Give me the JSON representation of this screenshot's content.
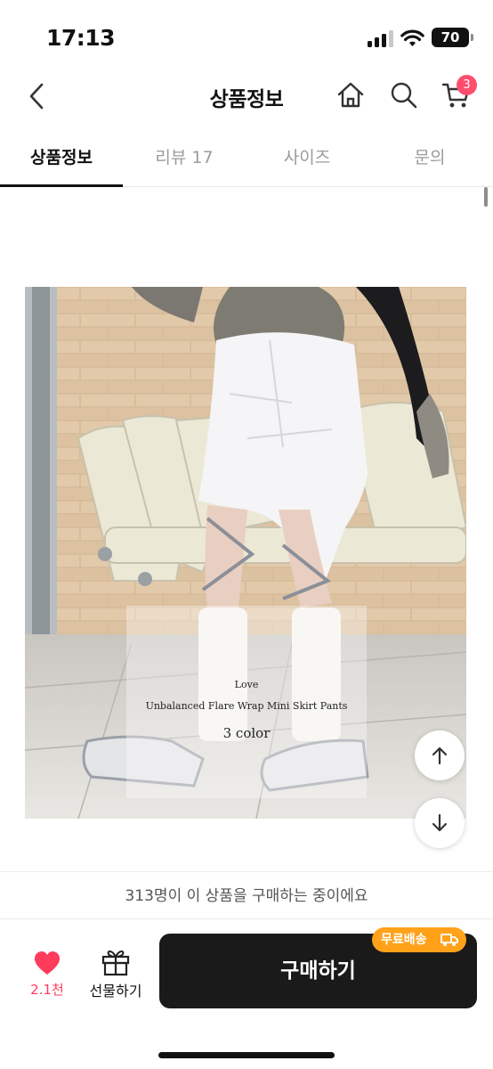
{
  "status_bar": {
    "time": "17:13",
    "battery": "70"
  },
  "header": {
    "title": "상품정보",
    "cart_count": "3"
  },
  "tabs": [
    {
      "label": "상품정보",
      "active": true
    },
    {
      "label": "리뷰 17",
      "active": false
    },
    {
      "label": "사이즈",
      "active": false
    },
    {
      "label": "문의",
      "active": false
    }
  ],
  "product_image": {
    "caption_brand": "Love",
    "caption_name": "Unbalanced Flare Wrap Mini Skirt Pants",
    "caption_colors": "3 color"
  },
  "purchase_note": "313명이 이 상품을 구매하는 중이에요",
  "bottom_bar": {
    "like_count": "2.1천",
    "gift_label": "선물하기",
    "buy_label": "구매하기",
    "free_shipping_badge": "무료배송"
  },
  "colors": {
    "accent_pink": "#ff3b5c",
    "badge_orange": "#ffa21a",
    "button_dark": "#1a1a1a"
  },
  "icons": [
    "back-arrow-icon",
    "home-icon",
    "search-icon",
    "cart-icon",
    "heart-icon",
    "gift-icon",
    "truck-icon",
    "arrow-up-icon",
    "arrow-down-icon"
  ]
}
